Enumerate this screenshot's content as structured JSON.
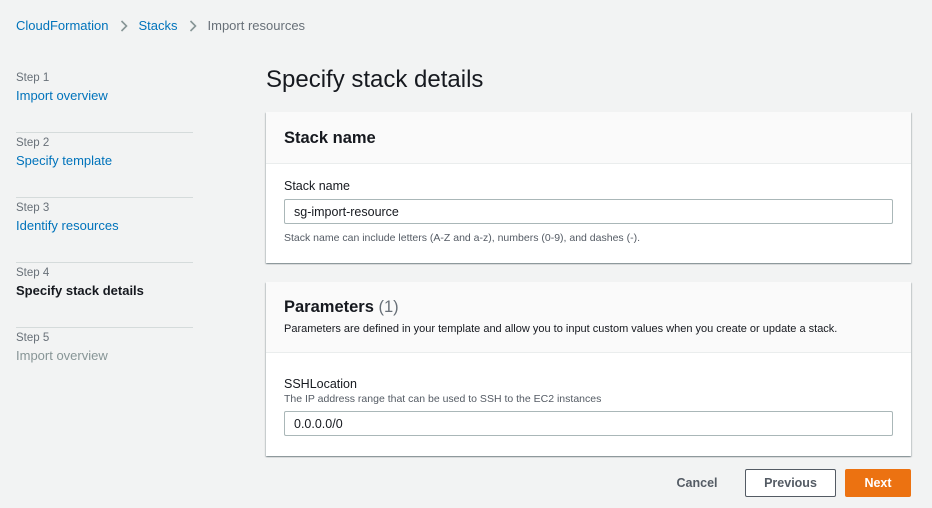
{
  "breadcrumb": {
    "items": [
      "CloudFormation",
      "Stacks"
    ],
    "current": "Import resources"
  },
  "steps": [
    {
      "num": "Step 1",
      "label": "Import overview",
      "state": "link"
    },
    {
      "num": "Step 2",
      "label": "Specify template",
      "state": "link"
    },
    {
      "num": "Step 3",
      "label": "Identify resources",
      "state": "link"
    },
    {
      "num": "Step 4",
      "label": "Specify stack details",
      "state": "active"
    },
    {
      "num": "Step 5",
      "label": "Import overview",
      "state": "disabled"
    }
  ],
  "page": {
    "title": "Specify stack details"
  },
  "stack_name_panel": {
    "title": "Stack name",
    "field_label": "Stack name",
    "value": "sg-import-resource",
    "help": "Stack name can include letters (A-Z and a-z), numbers (0-9), and dashes (-)."
  },
  "parameters_panel": {
    "title": "Parameters",
    "count": "(1)",
    "description": "Parameters are defined in your template and allow you to input custom values when you create or update a stack.",
    "params": [
      {
        "name": "SSHLocation",
        "description": "The IP address range that can be used to SSH to the EC2 instances",
        "value": "0.0.0.0/0"
      }
    ]
  },
  "footer": {
    "cancel_label": "Cancel",
    "previous_label": "Previous",
    "next_label": "Next"
  },
  "colors": {
    "link": "#0073bb",
    "primary_button": "#ec7211",
    "background": "#f2f3f3"
  },
  "icons": {
    "breadcrumb_separator": "chevron-right-icon"
  }
}
